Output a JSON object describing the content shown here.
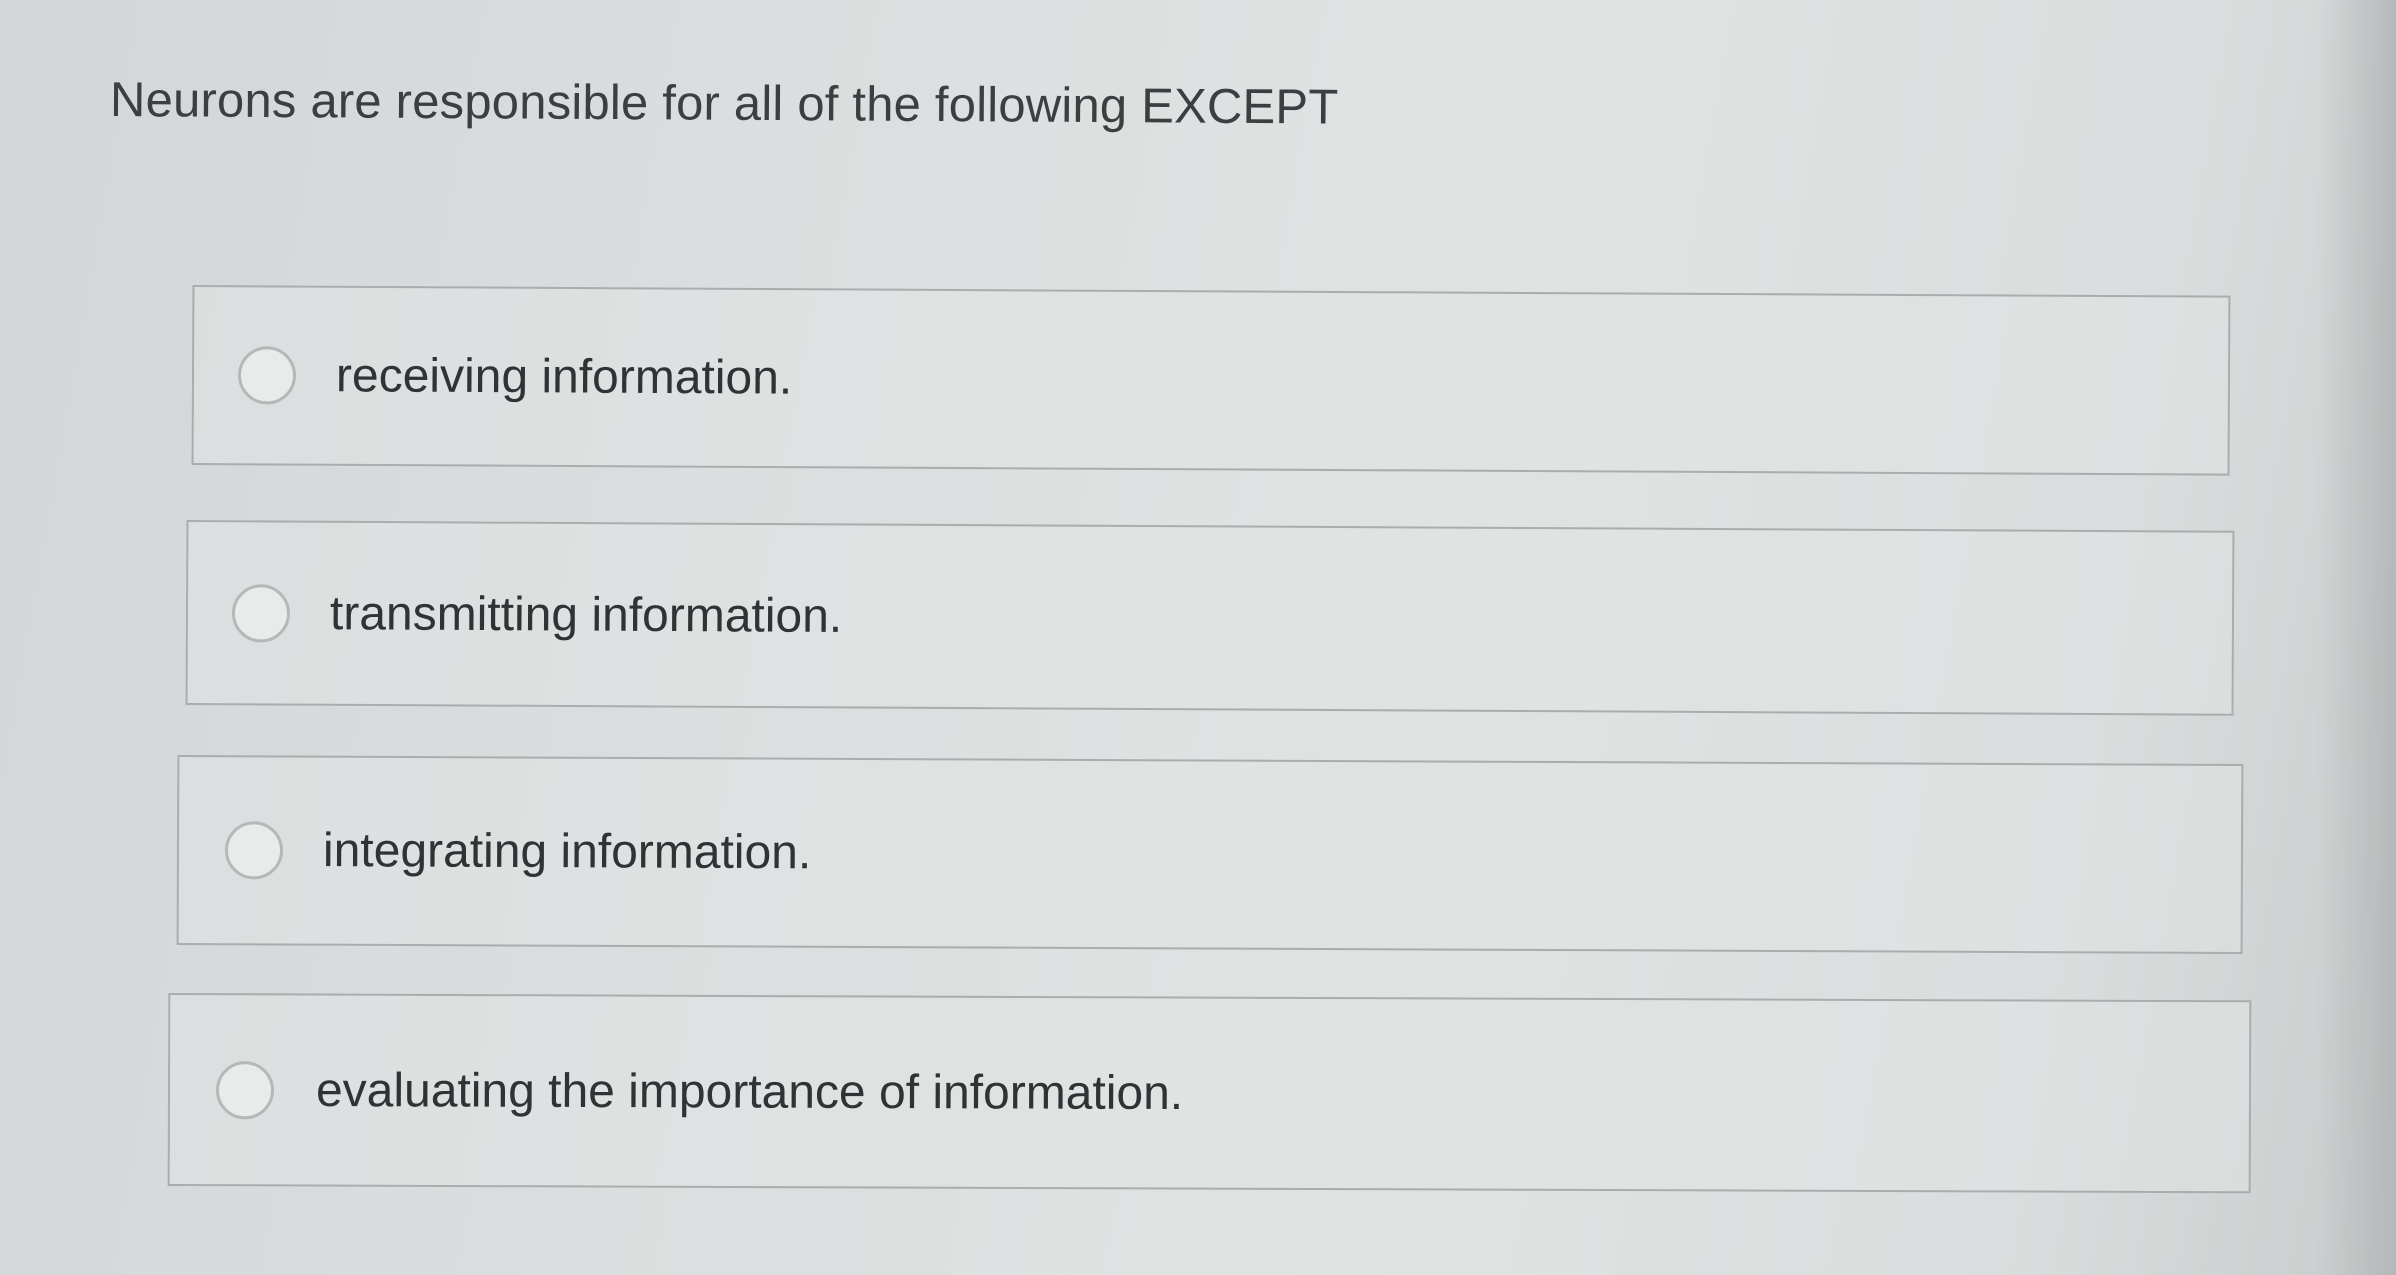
{
  "question": {
    "text": "Neurons are responsible for all of the following EXCEPT"
  },
  "choices": [
    {
      "label": "receiving information.",
      "selected": false
    },
    {
      "label": "transmitting information.",
      "selected": false
    },
    {
      "label": "integrating information.",
      "selected": false
    },
    {
      "label": "evaluating the importance of information.",
      "selected": false
    }
  ]
}
